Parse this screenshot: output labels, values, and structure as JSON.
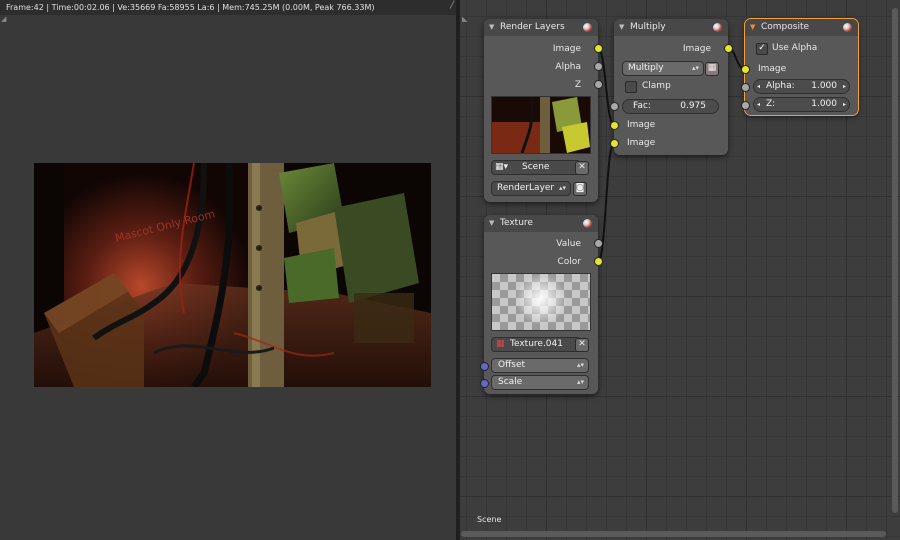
{
  "status": {
    "text": "Frame:42 | Time:00:02.06 | Ve:35669 Fa:58955 La:6 | Mem:745.25M (0.00M, Peak 766.33M)"
  },
  "render_image": {
    "sign_text": "Mascot Only Room"
  },
  "footer": {
    "scene_label": "Scene"
  },
  "nodes": {
    "render_layers": {
      "title": "Render Layers",
      "outputs": [
        "Image",
        "Alpha",
        "Z"
      ],
      "scene_value": "Scene",
      "layer_value": "RenderLayer"
    },
    "multiply": {
      "title": "Multiply",
      "output": "Image",
      "blend_mode": "Multiply",
      "clamp_label": "Clamp",
      "fac_label": "Fac:",
      "fac_value": "0.975",
      "input1": "Image",
      "input2": "Image"
    },
    "composite": {
      "title": "Composite",
      "use_alpha_label": "Use Alpha",
      "input_image": "Image",
      "alpha_label": "Alpha:",
      "alpha_value": "1.000",
      "z_label": "Z:",
      "z_value": "1.000"
    },
    "texture": {
      "title": "Texture",
      "outputs": [
        "Value",
        "Color"
      ],
      "texture_name": "Texture.041",
      "offset_label": "Offset",
      "scale_label": "Scale"
    }
  },
  "colors": {
    "socket_image": "#e5e52e",
    "socket_value": "#a8a8a8",
    "socket_vector": "#6666cc",
    "selected_outline": "#f0a040"
  }
}
